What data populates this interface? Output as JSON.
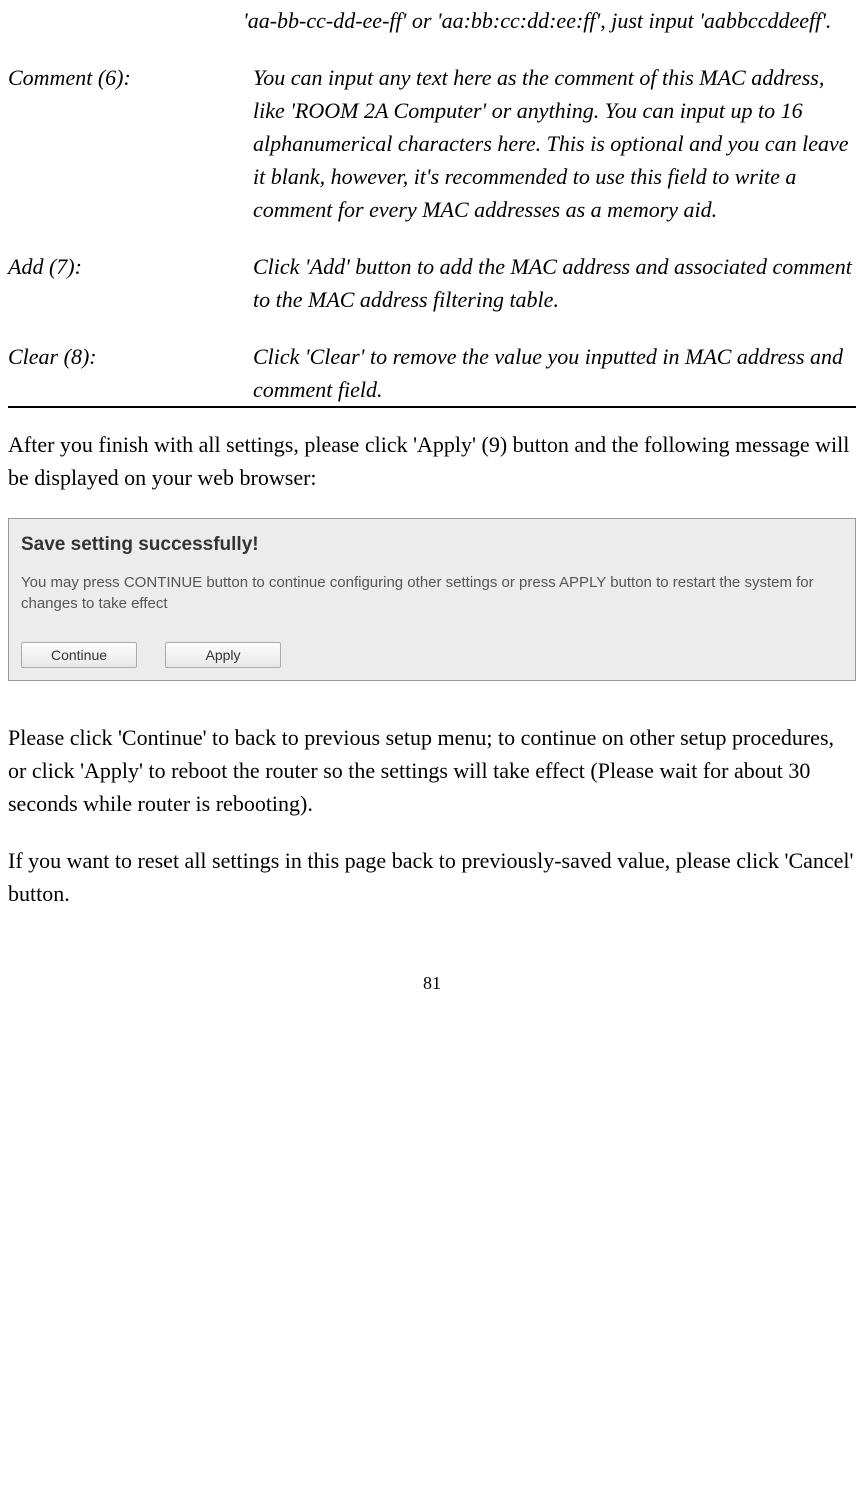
{
  "leading_fragment": "'aa-bb-cc-dd-ee-ff' or 'aa:bb:cc:dd:ee:ff', just input 'aabbccddeeff'.",
  "definitions": [
    {
      "term": "Comment (6):",
      "desc": "You can input any text here as the comment of this MAC address, like 'ROOM 2A Computer' or anything. You can input up to 16 alphanumerical characters here. This is optional and you can leave it blank, however, it's recommended to use this field to write a comment for every MAC addresses as a memory aid."
    },
    {
      "term": "Add (7):",
      "desc": "Click 'Add' button to add the MAC address and associated comment to the MAC address filtering table."
    },
    {
      "term": "Clear (8):",
      "desc": "Click 'Clear' to remove the value you inputted in MAC address and comment field."
    }
  ],
  "after_settings": "After you finish with all settings, please click 'Apply' (9) button and the following message will be displayed on your web browser:",
  "dialog": {
    "title": "Save setting successfully!",
    "message": "You may press CONTINUE button to continue configuring other settings or press APPLY button to restart the system for changes to take effect",
    "continue_label": "Continue",
    "apply_label": "Apply"
  },
  "please_click": "Please click 'Continue' to back to previous setup menu; to continue on other setup procedures, or click 'Apply' to reboot the router so the settings will take effect (Please wait for about 30 seconds while router is rebooting).",
  "reset_text": "If you want to reset all settings in this page back to previously-saved value, please click 'Cancel' button.",
  "page_number": "81"
}
